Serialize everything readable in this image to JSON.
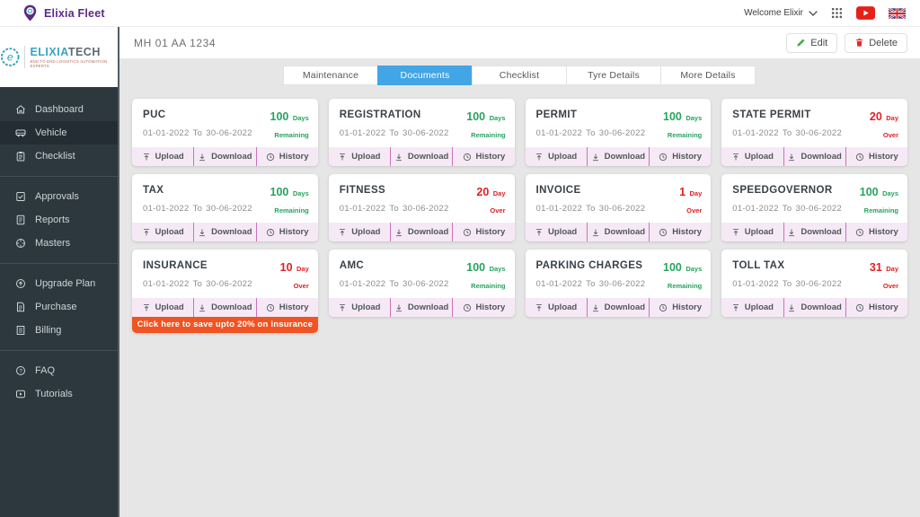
{
  "header": {
    "brand": "Elixia Fleet",
    "welcome": "Welcome Elixir"
  },
  "sidebar": {
    "logo_primary": "ELIXIA",
    "logo_secondary": "TECH",
    "logo_tagline": "END TO END LOGISTICS AUTOMATION EXPERTS",
    "groups": [
      {
        "items": [
          {
            "label": "Dashboard",
            "icon": "home",
            "active": false
          },
          {
            "label": "Vehicle",
            "icon": "truck",
            "active": true
          },
          {
            "label": "Checklist",
            "icon": "clipboard",
            "active": false
          }
        ]
      },
      {
        "items": [
          {
            "label": "Approvals",
            "icon": "approvals",
            "active": false
          },
          {
            "label": "Reports",
            "icon": "report",
            "active": false
          },
          {
            "label": "Masters",
            "icon": "masters",
            "active": false
          }
        ]
      },
      {
        "items": [
          {
            "label": "Upgrade Plan",
            "icon": "upgrade",
            "active": false
          },
          {
            "label": "Purchase",
            "icon": "purchase",
            "active": false
          },
          {
            "label": "Billing",
            "icon": "billing",
            "active": false
          }
        ]
      },
      {
        "items": [
          {
            "label": "FAQ",
            "icon": "faq",
            "active": false
          },
          {
            "label": "Tutorials",
            "icon": "tutorials",
            "active": false
          }
        ]
      }
    ]
  },
  "toolbar": {
    "vehicle_number": "MH 01 AA 1234",
    "edit_label": "Edit",
    "delete_label": "Delete"
  },
  "tabs": [
    {
      "label": "Maintenance",
      "active": false
    },
    {
      "label": "Documents",
      "active": true
    },
    {
      "label": "Checklist",
      "active": false
    },
    {
      "label": "Tyre Details",
      "active": false
    },
    {
      "label": "More Details",
      "active": false
    }
  ],
  "card_actions": {
    "upload": "Upload",
    "download": "Download",
    "history": "History"
  },
  "cards": [
    {
      "title": "PUC",
      "date_from": "01-01-2022",
      "to": "To",
      "date_to": "30-06-2022",
      "status": {
        "value": "100",
        "unit": "Days",
        "word": "Remaining",
        "type": "ok"
      }
    },
    {
      "title": "REGISTRATION",
      "date_from": "01-01-2022",
      "to": "To",
      "date_to": "30-06-2022",
      "status": {
        "value": "100",
        "unit": "Days",
        "word": "Remaining",
        "type": "ok"
      }
    },
    {
      "title": "PERMIT",
      "date_from": "01-01-2022",
      "to": "To",
      "date_to": "30-06-2022",
      "status": {
        "value": "100",
        "unit": "Days",
        "word": "Remaining",
        "type": "ok"
      }
    },
    {
      "title": "STATE PERMIT",
      "date_from": "01-01-2022",
      "to": "To",
      "date_to": "30-06-2022",
      "status": {
        "value": "20",
        "unit": "Day",
        "word": "Over",
        "type": "over"
      }
    },
    {
      "title": "TAX",
      "date_from": "01-01-2022",
      "to": "To",
      "date_to": "30-06-2022",
      "status": {
        "value": "100",
        "unit": "Days",
        "word": "Remaining",
        "type": "ok"
      }
    },
    {
      "title": "FITNESS",
      "date_from": "01-01-2022",
      "to": "To",
      "date_to": "30-06-2022",
      "status": {
        "value": "20",
        "unit": "Day",
        "word": "Over",
        "type": "over"
      }
    },
    {
      "title": "INVOICE",
      "date_from": "01-01-2022",
      "to": "To",
      "date_to": "30-06-2022",
      "status": {
        "value": "1",
        "unit": "Day",
        "word": "Over",
        "type": "over"
      }
    },
    {
      "title": "SPEEDGOVERNOR",
      "date_from": "01-01-2022",
      "to": "To",
      "date_to": "30-06-2022",
      "status": {
        "value": "100",
        "unit": "Days",
        "word": "Remaining",
        "type": "ok"
      }
    },
    {
      "title": "INSURANCE",
      "date_from": "01-01-2022",
      "to": "To",
      "date_to": "30-06-2022",
      "status": {
        "value": "10",
        "unit": "Day",
        "word": "Over",
        "type": "over"
      },
      "banner": "Click here to save upto 20% on insurance"
    },
    {
      "title": "AMC",
      "date_from": "01-01-2022",
      "to": "To",
      "date_to": "30-06-2022",
      "status": {
        "value": "100",
        "unit": "Days",
        "word": "Remaining",
        "type": "ok"
      }
    },
    {
      "title": "PARKING CHARGES",
      "date_from": "01-01-2022",
      "to": "To",
      "date_to": "30-06-2022",
      "status": {
        "value": "100",
        "unit": "Days",
        "word": "Remaining",
        "type": "ok"
      }
    },
    {
      "title": "TOLL TAX",
      "date_from": "01-01-2022",
      "to": "To",
      "date_to": "30-06-2022",
      "status": {
        "value": "31",
        "unit": "Day",
        "word": "Over",
        "type": "over"
      }
    }
  ],
  "colors": {
    "accent_blue": "#42a5e5",
    "ok_green": "#27a35f",
    "over_red": "#df1f26",
    "banner_orange": "#f05423",
    "sidebar_dark": "#2d383e",
    "brand_purple": "#5b2b87"
  }
}
